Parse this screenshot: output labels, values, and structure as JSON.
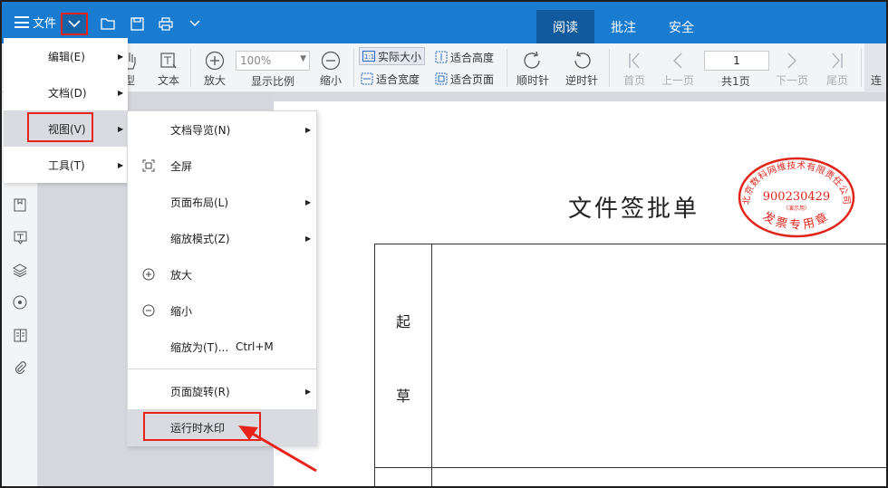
{
  "titlebar": {
    "file_menu_label": "文件",
    "tabs": [
      {
        "label": "阅读",
        "active": true
      },
      {
        "label": "批注",
        "active": false
      },
      {
        "label": "安全",
        "active": false
      }
    ],
    "accent_color": "#1a7cd0"
  },
  "toolbar": {
    "partial_label": "型",
    "text_label": "文本",
    "zoom_in_label": "放大",
    "zoom_value": "100%",
    "zoom_ratio_label": "显示比例",
    "zoom_out_label": "缩小",
    "actual_size_label": "实际大小",
    "fit_height_label": "适合高度",
    "fit_width_label": "适合宽度",
    "fit_page_label": "适合页面",
    "rotate_cw_label": "顺时针",
    "rotate_ccw_label": "逆时针",
    "first_page_label": "首页",
    "prev_page_label": "上一页",
    "page_input_value": "1",
    "total_pages_label": "共1页",
    "next_page_label": "下一页",
    "last_page_label": "尾页",
    "continuous_label": "连"
  },
  "main_menu": {
    "items": [
      {
        "label": "编辑(E)",
        "has_submenu": true
      },
      {
        "label": "文档(D)",
        "has_submenu": true
      },
      {
        "label": "视图(V)",
        "has_submenu": true,
        "selected": true
      },
      {
        "label": "工具(T)",
        "has_submenu": true
      }
    ]
  },
  "view_submenu": {
    "items": [
      {
        "label": "文档导览(N)",
        "icon": "",
        "has_submenu": true
      },
      {
        "label": "全屏",
        "icon": "fullscreen-icon",
        "has_submenu": false
      },
      {
        "label": "页面布局(L)",
        "icon": "",
        "has_submenu": true
      },
      {
        "label": "缩放模式(Z)",
        "icon": "",
        "has_submenu": true
      },
      {
        "label": "放大",
        "icon": "zoom-in-icon",
        "has_submenu": false
      },
      {
        "label": "缩小",
        "icon": "zoom-out-icon",
        "has_submenu": false
      },
      {
        "label": "缩放为(T)...",
        "shortcut": "Ctrl+M",
        "icon": "",
        "has_submenu": false
      },
      {
        "label": "页面旋转(R)",
        "icon": "",
        "has_submenu": true
      },
      {
        "label": "运行时水印",
        "icon": "",
        "has_submenu": false,
        "selected": true
      }
    ]
  },
  "document": {
    "title": "文件签批单",
    "row_label_chars": [
      "起",
      "草"
    ],
    "seal": {
      "top_text": "北京数科网维技术有限责任公司",
      "number": "900230429",
      "note": "（演示用）",
      "bottom_text": "发票专用章",
      "color": "#e0251b"
    }
  },
  "annotation_color": "#e8231a"
}
